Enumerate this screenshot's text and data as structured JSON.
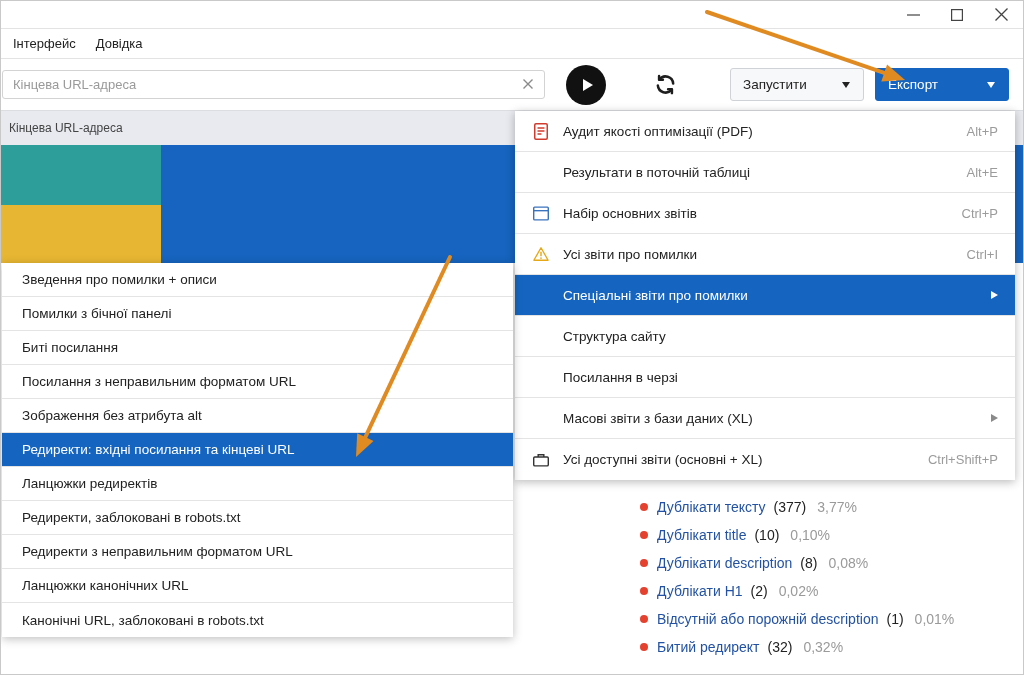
{
  "menu_bar": [
    "Інтерфейс",
    "Довідка"
  ],
  "toolbar": {
    "search": {
      "placeholder": "Кінцева URL-адреса"
    },
    "run_button": {
      "label": "Запустити"
    },
    "export_button": {
      "label": "Експорт"
    }
  },
  "table": {
    "columns": [
      "Кінцева URL-адреса"
    ]
  },
  "issues": [
    {
      "label": "Дублікати тексту",
      "count": "(377)",
      "share": "3,77%",
      "color": "#e5412f"
    },
    {
      "label": "Дублікати title",
      "count": "(10)",
      "share": "0,10%",
      "color": "#e5412f"
    },
    {
      "label": "Дублікати description",
      "count": "(8)",
      "share": "0,08%",
      "color": "#e5412f"
    },
    {
      "label": "Дублікати H1",
      "count": "(2)",
      "share": "0,02%",
      "color": "#e5412f"
    },
    {
      "label": "Відсутній або порожній description",
      "count": "(1)",
      "share": "0,01%",
      "color": "#e5412f"
    },
    {
      "label": "Битий редирект",
      "count": "(32)",
      "share": "0,32%",
      "color": "#e5412f"
    }
  ],
  "export_menu": {
    "items": [
      {
        "label": "Аудит якості оптимізації (PDF)",
        "shortcut": "Alt+P",
        "kind": "document",
        "submenu": false,
        "selected": false
      },
      {
        "label": "Результати в поточній таблиці",
        "shortcut": "Alt+E",
        "kind": "plain",
        "submenu": false,
        "selected": false
      },
      {
        "label": "Набір основних звітів",
        "shortcut": "Ctrl+P",
        "kind": "window",
        "submenu": false,
        "selected": false
      },
      {
        "label": "Усі звіти про помилки",
        "shortcut": "Ctrl+I",
        "kind": "warning",
        "submenu": false,
        "selected": false
      },
      {
        "label": "Спеціальні звіти про помилки",
        "kind": "plain",
        "submenu": true,
        "selected": true
      },
      {
        "label": "Структура сайту",
        "kind": "plain",
        "submenu": false,
        "selected": false
      },
      {
        "label": "Посилання в черзі",
        "kind": "plain",
        "submenu": false,
        "selected": false
      },
      {
        "label": "Масові звіти з бази даних (XL)",
        "kind": "plain",
        "submenu": true,
        "selected": false
      },
      {
        "label": "Усі доступні звіти (основні + XL)",
        "shortcut": "Ctrl+Shift+P",
        "kind": "briefcase",
        "submenu": false,
        "selected": false
      }
    ]
  },
  "submenu": {
    "items": [
      {
        "label": "Зведення про помилки + описи",
        "selected": false
      },
      {
        "label": "Помилки з бічної панелі",
        "selected": false
      },
      {
        "label": "Биті посилання",
        "selected": false
      },
      {
        "label": "Посилання з неправильним форматом URL",
        "selected": false
      },
      {
        "label": "Зображення без атрибута alt",
        "selected": false
      },
      {
        "label": "Редиректи: вхідні посилання та кінцеві URL",
        "selected": true
      },
      {
        "label": "Ланцюжки редиректів",
        "selected": false
      },
      {
        "label": "Редиректи, заблоковані в robots.txt",
        "selected": false
      },
      {
        "label": "Редиректи з неправильним форматом URL",
        "selected": false
      },
      {
        "label": "Ланцюжки канонічних URL",
        "selected": false
      },
      {
        "label": "Канонічні URL, заблоковані в robots.txt",
        "selected": false
      }
    ]
  }
}
